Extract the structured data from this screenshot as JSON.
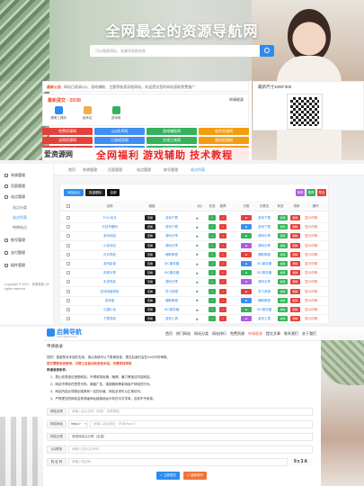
{
  "nav_site": {
    "title": "全网最全的资源导航网",
    "search_placeholder": "可以搜索网址，关键词导航名称",
    "notice_tag": "最新公告",
    "notice_text": "网站已收录QQ、游戏辅助、主题等各类导航网站，欢迎提交您的网站获取免费推广",
    "mini_title": "最新提交 · 20/38",
    "mini_more": "申请收录",
    "apps": [
      "透明工具网",
      "技术站",
      "游戏网"
    ],
    "qr_title": "最新尺寸1000*300",
    "categories": [
      [
        "免费资源网",
        "QQ技术网",
        "游戏辅助网",
        "软件资源网"
      ],
      [
        "全网资源网",
        "小游戏导航",
        "在线工具网",
        "源码资源网"
      ],
      [
        "免费服务网",
        "主题下载网",
        "影视资源网",
        "名站导航网"
      ]
    ],
    "banner_logo": "爱资源网",
    "banner_text": "全网福利 游戏辅助 技术教程"
  },
  "admin": {
    "menu": [
      {
        "label": "系统管理"
      },
      {
        "label": "页面管理"
      },
      {
        "label": "站点管理"
      },
      {
        "label": "账号管理"
      },
      {
        "label": "支付管理"
      },
      {
        "label": "插件管理"
      }
    ],
    "submenu": [
      "站点分类",
      "站点列表",
      "待审站点"
    ],
    "copyright": "Copyright © 2021 · 资源导航 All rights reserved",
    "tabs": [
      "首页",
      "系统管理",
      "页面管理",
      "站点管理",
      "账号管理",
      "站点列表"
    ],
    "tools": [
      "添加站点",
      "批量删除",
      "全部",
      "审核",
      "推荐",
      "导出"
    ],
    "columns": [
      "名称",
      "链接",
      "QQ",
      "状态",
      "推荐",
      "分类",
      "分类名",
      "状态",
      "排序",
      "操作"
    ],
    "rows": [
      {
        "name": "TH小站长",
        "cat": "游戏下载"
      },
      {
        "name": "日站专题网",
        "cat": "游戏下载"
      },
      {
        "name": "游戏网站",
        "cat": "源码分享"
      },
      {
        "name": "小游戏站",
        "cat": "源码分享"
      },
      {
        "name": "月月导航",
        "cat": "辅助教程"
      },
      {
        "name": "游戏影视",
        "cat": "IDC服务器"
      },
      {
        "name": "资源分享",
        "cat": "IDC服务器"
      },
      {
        "name": "天卓导航",
        "cat": "源码分享"
      },
      {
        "name": "在线测速导航",
        "cat": "学习资源"
      },
      {
        "name": "游戏宝",
        "cat": "辅助教程"
      },
      {
        "name": "达通小站",
        "cat": "IDC服务器"
      },
      {
        "name": "下载导航",
        "cat": "游戏工具"
      }
    ],
    "link_badge": "查看",
    "status": "已审核",
    "op_edit": "编辑",
    "op_delete": "删除",
    "op_extra": "显示详情"
  },
  "apply_form": {
    "logo": "启舞导航",
    "logo_sub": "www.qiwudh.com",
    "nav": [
      "首页",
      "热门网站",
      "网站分类",
      "网站排行",
      "免费资源",
      "申请收录",
      "提交文章",
      "联系我们",
      "关于我们"
    ],
    "title": "申请收录",
    "intro": "您好！感谢您对本站的支持，请认真填写以下表单信息，提交后我们会在24小时内审核。",
    "pay_note": "提交需要收录费用，付费之后自动收录到本站，无需等待审核",
    "rules_title": "申请收录条件：",
    "rules": [
      "1、禁止收录违法违规网站，不得收录色情、赌博、暴力等违法内容网站。",
      "2、网站不得存在恶意代码、弹窗广告、强制跳转等影响用户体验的行为。",
      "3、网站内容必须原创或具有一定的价值，网站必须可以正常访问。",
      "4、严禁提交的网站名称或者网址链接地址中存在中文字母，否则不予收录。"
    ],
    "fields": [
      {
        "label": "网站名称",
        "placeholder": "请输入站点名称（例如：资源导航）"
      },
      {
        "label": "网站网址",
        "select": "https://",
        "placeholder": "请输入站点网址（不带https://）"
      },
      {
        "label": "网站分类",
        "placeholder": "请选择站点分类（必选）"
      },
      {
        "label": "QQ联系",
        "placeholder": "请输入站长QQ号码"
      },
      {
        "label": "验 证 码",
        "placeholder": "请输入验证码",
        "captcha": "9x3A"
      }
    ],
    "submit": "立即提交",
    "reset": "重新填写"
  },
  "colors": {
    "primary": "#2d8cf0",
    "danger": "#e53333",
    "success": "#2b9b5e",
    "cat_red": "#e6403a",
    "cat_blue": "#3f8ef0",
    "cat_green": "#35b25b",
    "cat_orange": "#f39c12"
  }
}
